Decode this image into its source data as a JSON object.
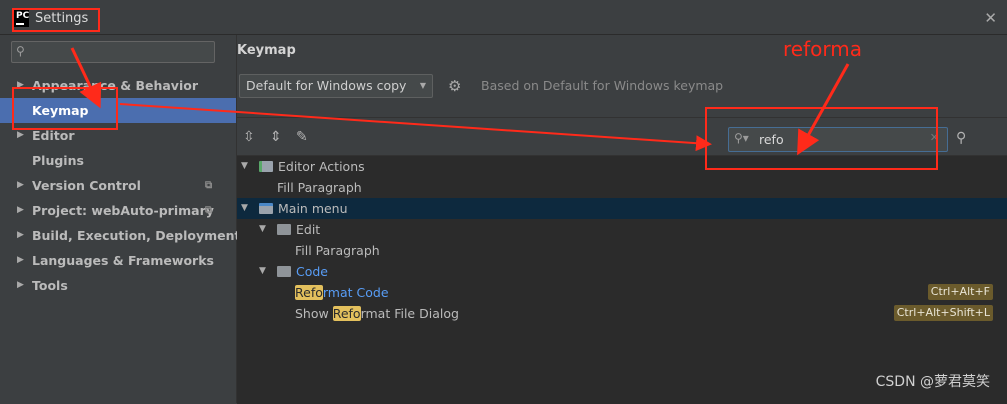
{
  "window": {
    "title": "Settings",
    "app_icon": "pycharm-logo",
    "app_icon_text": "PC"
  },
  "sidebar": {
    "search_placeholder": "",
    "items": [
      {
        "label": "Appearance & Behavior",
        "expandable": true,
        "selected": false,
        "copy_icon": false
      },
      {
        "label": "Keymap",
        "expandable": false,
        "selected": true,
        "copy_icon": false
      },
      {
        "label": "Editor",
        "expandable": true,
        "selected": false,
        "copy_icon": false
      },
      {
        "label": "Plugins",
        "expandable": false,
        "selected": false,
        "copy_icon": false
      },
      {
        "label": "Version Control",
        "expandable": true,
        "selected": false,
        "copy_icon": true
      },
      {
        "label": "Project: webAuto-primary",
        "expandable": true,
        "selected": false,
        "copy_icon": true
      },
      {
        "label": "Build, Execution, Deployment",
        "expandable": true,
        "selected": false,
        "copy_icon": false
      },
      {
        "label": "Languages & Frameworks",
        "expandable": true,
        "selected": false,
        "copy_icon": false
      },
      {
        "label": "Tools",
        "expandable": true,
        "selected": false,
        "copy_icon": false
      }
    ]
  },
  "main": {
    "section_title": "Keymap",
    "keymap_selected": "Default for Windows copy",
    "based_on": "Based on Default for Windows keymap",
    "filter_value": "refo",
    "tree": [
      {
        "text_before": "",
        "highlight": "",
        "text_after": "Editor Actions",
        "level": 0,
        "arrow": "down",
        "icon": "editor-actions",
        "selected": false,
        "link": false,
        "shortcut": ""
      },
      {
        "text_before": "",
        "highlight": "",
        "text_after": "Fill Paragraph",
        "level": 1,
        "arrow": "",
        "icon": "",
        "selected": false,
        "link": false,
        "shortcut": ""
      },
      {
        "text_before": "",
        "highlight": "",
        "text_after": "Main menu",
        "level": 0,
        "arrow": "down",
        "icon": "menu",
        "selected": true,
        "link": false,
        "shortcut": ""
      },
      {
        "text_before": "",
        "highlight": "",
        "text_after": "Edit",
        "level": 1,
        "arrow": "down",
        "icon": "folder",
        "selected": false,
        "link": false,
        "shortcut": ""
      },
      {
        "text_before": "",
        "highlight": "",
        "text_after": "Fill Paragraph",
        "level": 2,
        "arrow": "",
        "icon": "",
        "selected": false,
        "link": false,
        "shortcut": ""
      },
      {
        "text_before": "",
        "highlight": "",
        "text_after": "Code",
        "level": 1,
        "arrow": "down",
        "icon": "folder",
        "selected": false,
        "link": true,
        "shortcut": ""
      },
      {
        "text_before": "",
        "highlight": "Refo",
        "text_after": "rmat Code",
        "level": 2,
        "arrow": "",
        "icon": "",
        "selected": false,
        "link": true,
        "shortcut": "Ctrl+Alt+F"
      },
      {
        "text_before": "Show ",
        "highlight": "Refo",
        "text_after": "rmat File Dialog",
        "level": 2,
        "arrow": "",
        "icon": "",
        "selected": false,
        "link": false,
        "shortcut": "Ctrl+Alt+Shift+L"
      }
    ]
  },
  "annotation": {
    "label": "reforma",
    "color": "#ff2a1a"
  },
  "watermark": "CSDN @萝君莫笑",
  "colors": {
    "background": "#3c3f41",
    "tree_background": "#2b2b2b",
    "selection": "#4b6eaf",
    "search_highlight": "#e3c05d",
    "link": "#589df6"
  }
}
